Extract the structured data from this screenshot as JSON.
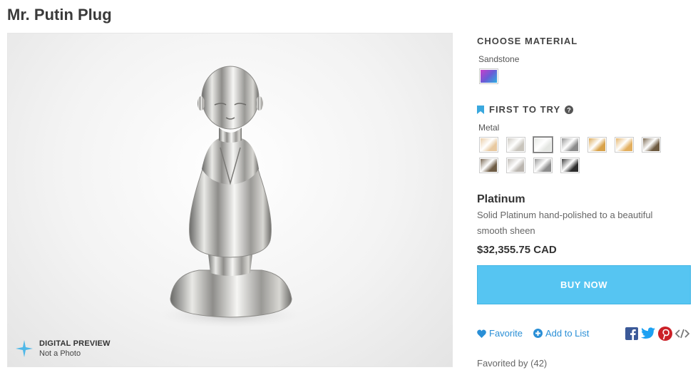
{
  "product": {
    "title": "Mr. Putin Plug"
  },
  "preview": {
    "badge_title": "DIGITAL PREVIEW",
    "badge_sub": "Not a Photo"
  },
  "materials": {
    "heading": "CHOOSE MATERIAL",
    "sandstone_label": "Sandstone",
    "first_to_try": "FIRST TO TRY",
    "metal_label": "Metal",
    "metal_swatches": [
      {
        "name": "metal-swatch-1",
        "color": "#e8c9a0"
      },
      {
        "name": "metal-swatch-2",
        "color": "#c8c4bc"
      },
      {
        "name": "metal-swatch-platinum",
        "color": "#e4e6e2",
        "selected": true
      },
      {
        "name": "metal-swatch-4",
        "color": "#8a8a8a"
      },
      {
        "name": "metal-swatch-5",
        "color": "#d8a24a"
      },
      {
        "name": "metal-swatch-6",
        "color": "#e2ae5e"
      },
      {
        "name": "metal-swatch-7",
        "color": "#6d5a40"
      },
      {
        "name": "metal-swatch-8",
        "color": "#6e5c45"
      },
      {
        "name": "metal-swatch-9",
        "color": "#b9b4ae"
      },
      {
        "name": "metal-swatch-10",
        "color": "#8c8c8c"
      },
      {
        "name": "metal-swatch-11",
        "color": "#2c2c2c"
      }
    ]
  },
  "selected_material": {
    "name": "Platinum",
    "description": "Solid Platinum hand-polished to a beautiful smooth sheen",
    "price": "$32,355.75 CAD"
  },
  "buy_button": "BUY NOW",
  "actions": {
    "favorite": "Favorite",
    "add_to_list": "Add to List",
    "favorited_by": "Favorited by (42)"
  },
  "colors": {
    "accent": "#56c5f2",
    "link": "#2a8fd6",
    "facebook": "#3b5998",
    "twitter": "#1da1f2",
    "pinterest": "#cb2027"
  }
}
